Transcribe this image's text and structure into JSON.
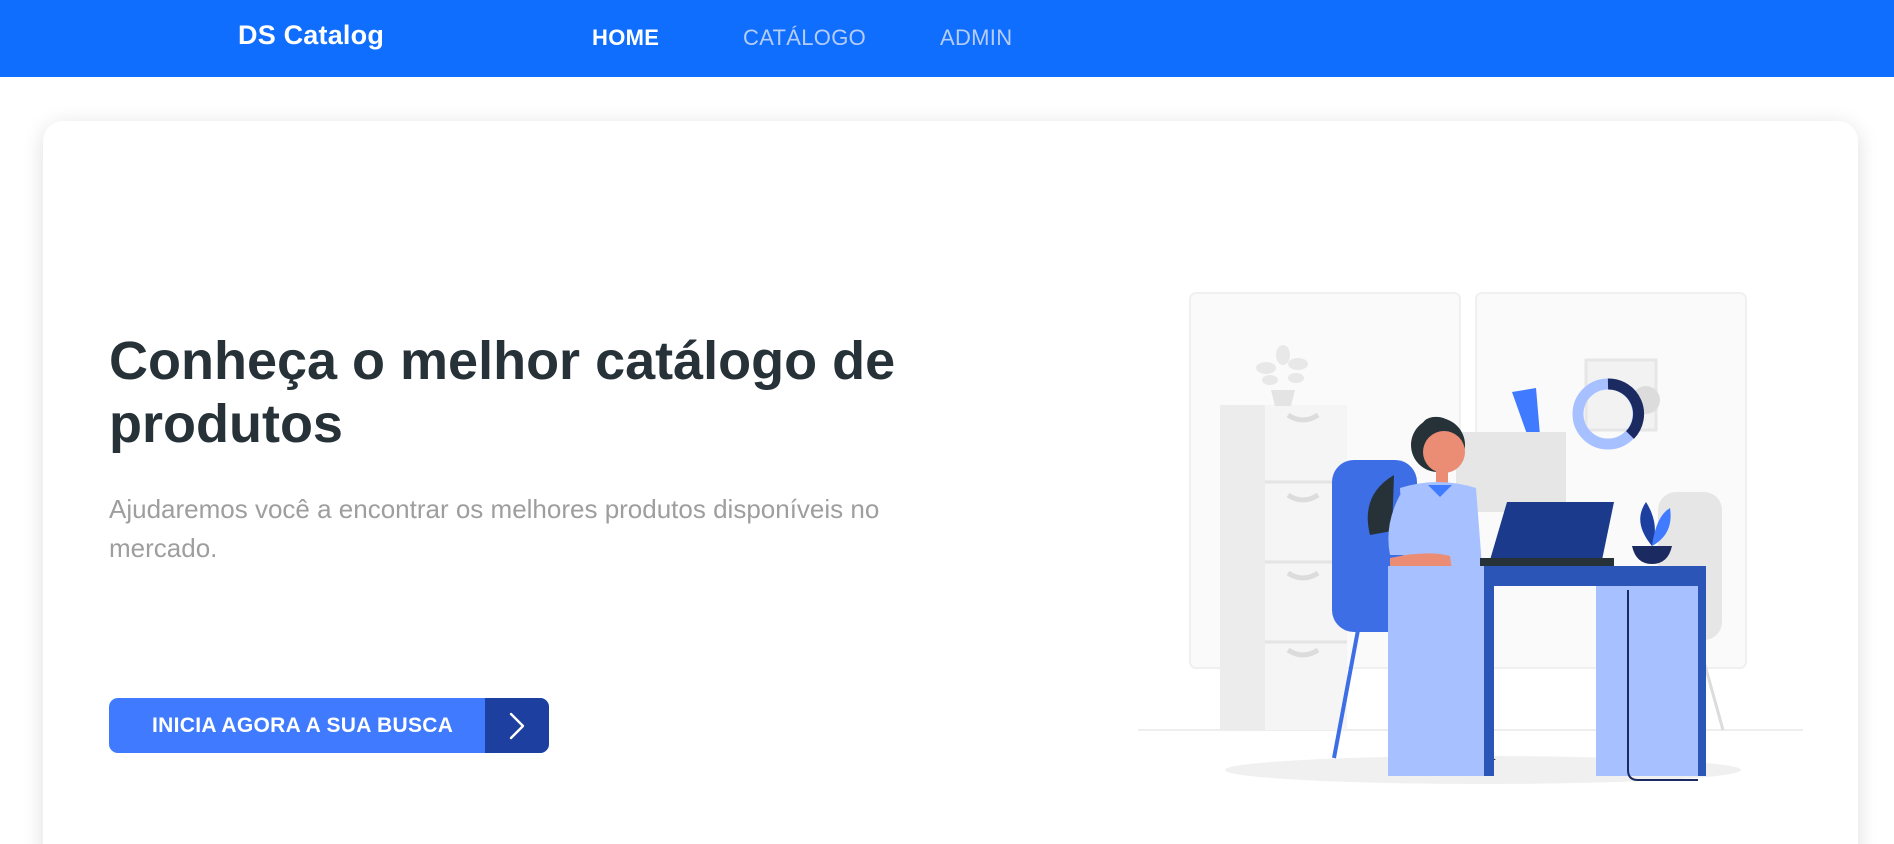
{
  "navbar": {
    "brand": "DS Catalog",
    "links": [
      {
        "label": "HOME",
        "active": true
      },
      {
        "label": "CATÁLOGO",
        "active": false
      },
      {
        "label": "ADMIN",
        "active": false
      }
    ]
  },
  "hero": {
    "title": "Conheça o melhor catálogo de produtos",
    "subtitle": "Ajudaremos você a encontrar os melhores produtos disponíveis no mercado.",
    "cta_label": "INICIA AGORA A SUA BUSCA",
    "cta_icon": "chevron-right-icon",
    "illustration": "woman-at-desk-with-laptop-illustration"
  },
  "colors": {
    "navbar": "#0f6efd",
    "button": "#407bff",
    "button_arrow": "#1d40a0",
    "title": "#263238",
    "subtitle": "#9e9e9e"
  }
}
